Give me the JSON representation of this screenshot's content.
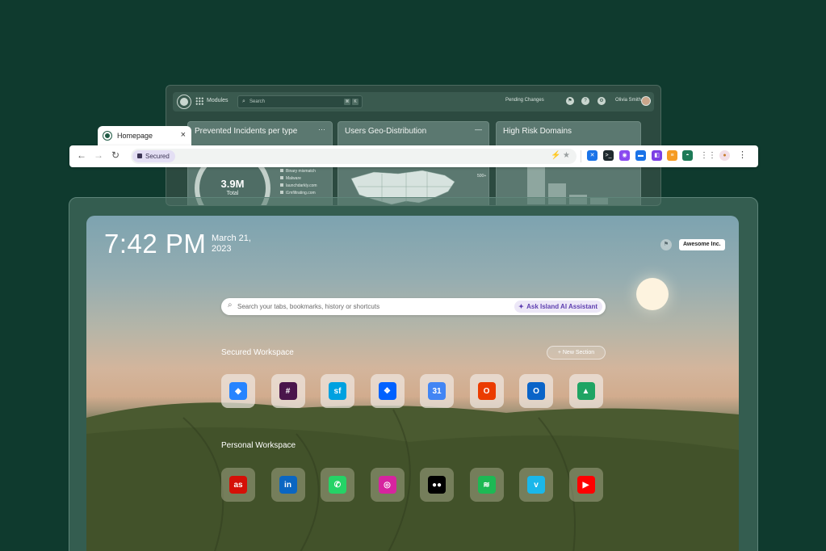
{
  "dashboard": {
    "modules_label": "Modules",
    "search_placeholder": "Search",
    "pending_label": "Pending Changes",
    "user_name": "Olivia Smith",
    "cards": [
      {
        "title": "Prevented Incidents per type",
        "value": "3.9M",
        "sub": "Total",
        "legend": [
          "Binary mismatch",
          "Malware",
          "launchdarkly.com",
          "t1mfiltrating.com"
        ]
      },
      {
        "title": "Users Geo-Distribution",
        "map_label": "500+"
      },
      {
        "title": "High Risk Domains"
      }
    ]
  },
  "browser": {
    "tab_title": "Homepage",
    "security_label": "Secured",
    "extension_colors": [
      "#1a73e8",
      "#1f2a2e",
      "#8a4af0",
      "#1a73e8",
      "#7b3fe4",
      "#f59b23",
      "#1d7a57"
    ]
  },
  "newtab": {
    "time": "7:42 PM",
    "date_line1": "March 21,",
    "date_line2": "2023",
    "org_name": "Awesome Inc.",
    "search_placeholder": "Search your tabs, bookmarks, history or shortcuts",
    "ai_button": "Ask Island AI Assistant",
    "secured_workspace": {
      "title": "Secured Workspace",
      "new_section": "New Section",
      "apps": [
        {
          "name": "jira",
          "color": "#2684ff",
          "glyph": "◆"
        },
        {
          "name": "slack",
          "color": "#4a154b",
          "glyph": "#"
        },
        {
          "name": "salesforce",
          "color": "#00a1e0",
          "glyph": "sf"
        },
        {
          "name": "dropbox",
          "color": "#0061ff",
          "glyph": "❖"
        },
        {
          "name": "google-calendar",
          "color": "#4285f4",
          "glyph": "31"
        },
        {
          "name": "office",
          "color": "#eb3c00",
          "glyph": "O"
        },
        {
          "name": "outlook",
          "color": "#0a64c8",
          "glyph": "O"
        },
        {
          "name": "google-drive",
          "color": "#1fa463",
          "glyph": "▲"
        }
      ]
    },
    "personal_workspace": {
      "title": "Personal Workspace",
      "apps": [
        {
          "name": "lastfm",
          "color": "#d51007",
          "glyph": "as"
        },
        {
          "name": "linkedin",
          "color": "#0a66c2",
          "glyph": "in"
        },
        {
          "name": "whatsapp",
          "color": "#25d366",
          "glyph": "✆"
        },
        {
          "name": "instagram",
          "color": "#d6249f",
          "glyph": "◎"
        },
        {
          "name": "medium",
          "color": "#000000",
          "glyph": "●●"
        },
        {
          "name": "spotify",
          "color": "#1db954",
          "glyph": "≋"
        },
        {
          "name": "vimeo",
          "color": "#1ab7ea",
          "glyph": "v"
        },
        {
          "name": "youtube",
          "color": "#ff0000",
          "glyph": "▶"
        }
      ]
    }
  }
}
